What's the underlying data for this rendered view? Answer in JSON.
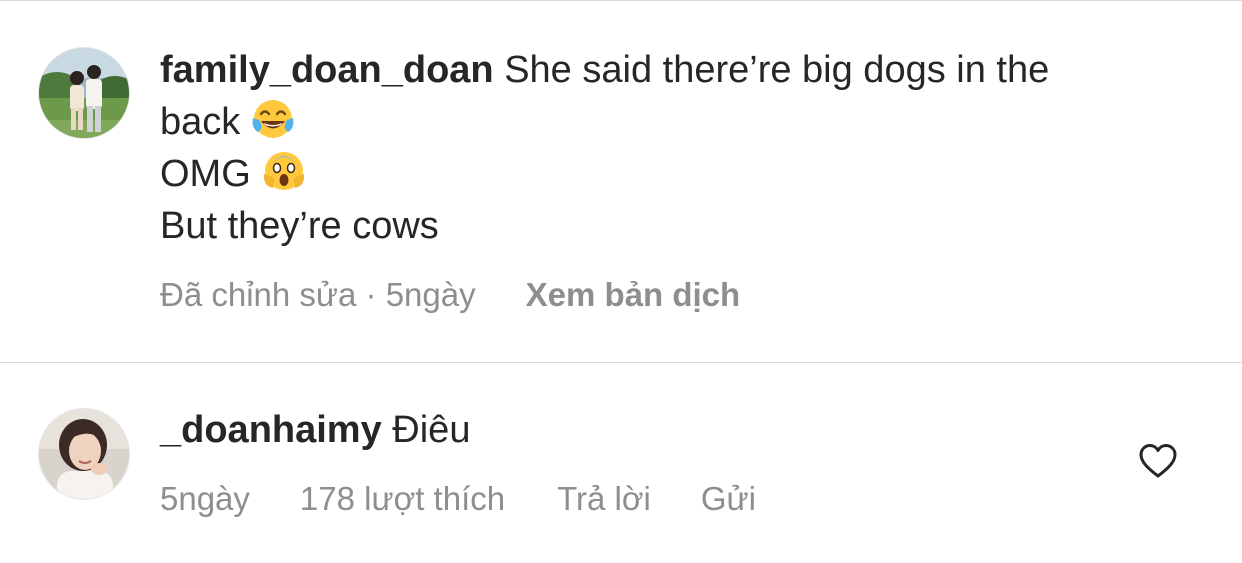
{
  "comment1": {
    "username": "family_doan_doan",
    "text_line1": "She said there’re big dogs in the",
    "text_line2": "back",
    "text_line3": "OMG",
    "text_line4": "But they’re cows",
    "emoji1": "tears-of-joy-emoji",
    "emoji2": "screaming-in-fear-emoji",
    "edited_label": "Đã chỉnh sửa",
    "separator": "·",
    "time": "5ngày",
    "translate_label": "Xem bản dịch"
  },
  "comment2": {
    "username": "_doanhaimy",
    "text": "Điêu",
    "time": "5ngày",
    "likes_label": "178 lượt thích",
    "reply_label": "Trả lời",
    "send_label": "Gửi",
    "like_icon": "heart-outline-icon"
  },
  "colors": {
    "text": "#262626",
    "secondary": "#8e8e8e",
    "divider": "#dbdbdb",
    "emoji_yellow": "#ffc83d"
  }
}
